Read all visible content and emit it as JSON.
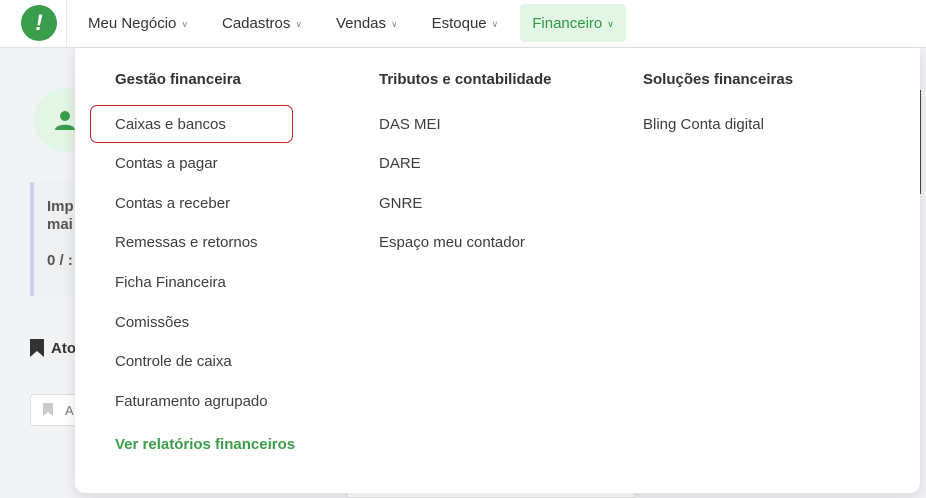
{
  "nav": {
    "logo_glyph": "!",
    "items": [
      {
        "label": "Meu Negócio"
      },
      {
        "label": "Cadastros"
      },
      {
        "label": "Vendas"
      },
      {
        "label": "Estoque"
      },
      {
        "label": "Financeiro"
      }
    ],
    "active": "Financeiro",
    "accent_color": "#3a9d4b",
    "active_bg_color": "#e3f5e5"
  },
  "background": {
    "card_text_1": "Imp",
    "card_text_2": "mai",
    "card_text_3": "0 / :",
    "section_text": "Ato",
    "input_text": "A"
  },
  "dropdown": {
    "columns": [
      {
        "title": "Gestão financeira",
        "items": [
          "Caixas e bancos",
          "Contas a pagar",
          "Contas a receber",
          "Remessas e retornos",
          "Ficha Financeira",
          "Comissões",
          "Controle de caixa",
          "Faturamento agrupado"
        ],
        "footer_link": "Ver relatórios financeiros"
      },
      {
        "title": "Tributos e contabilidade",
        "items": [
          "DAS MEI",
          "DARE",
          "GNRE",
          "Espaço meu contador"
        ]
      },
      {
        "title": "Soluções financeiras",
        "items": [
          "Bling Conta digital"
        ]
      }
    ],
    "highlighted_item": "Caixas e bancos",
    "highlight_color": "#d0202a"
  }
}
